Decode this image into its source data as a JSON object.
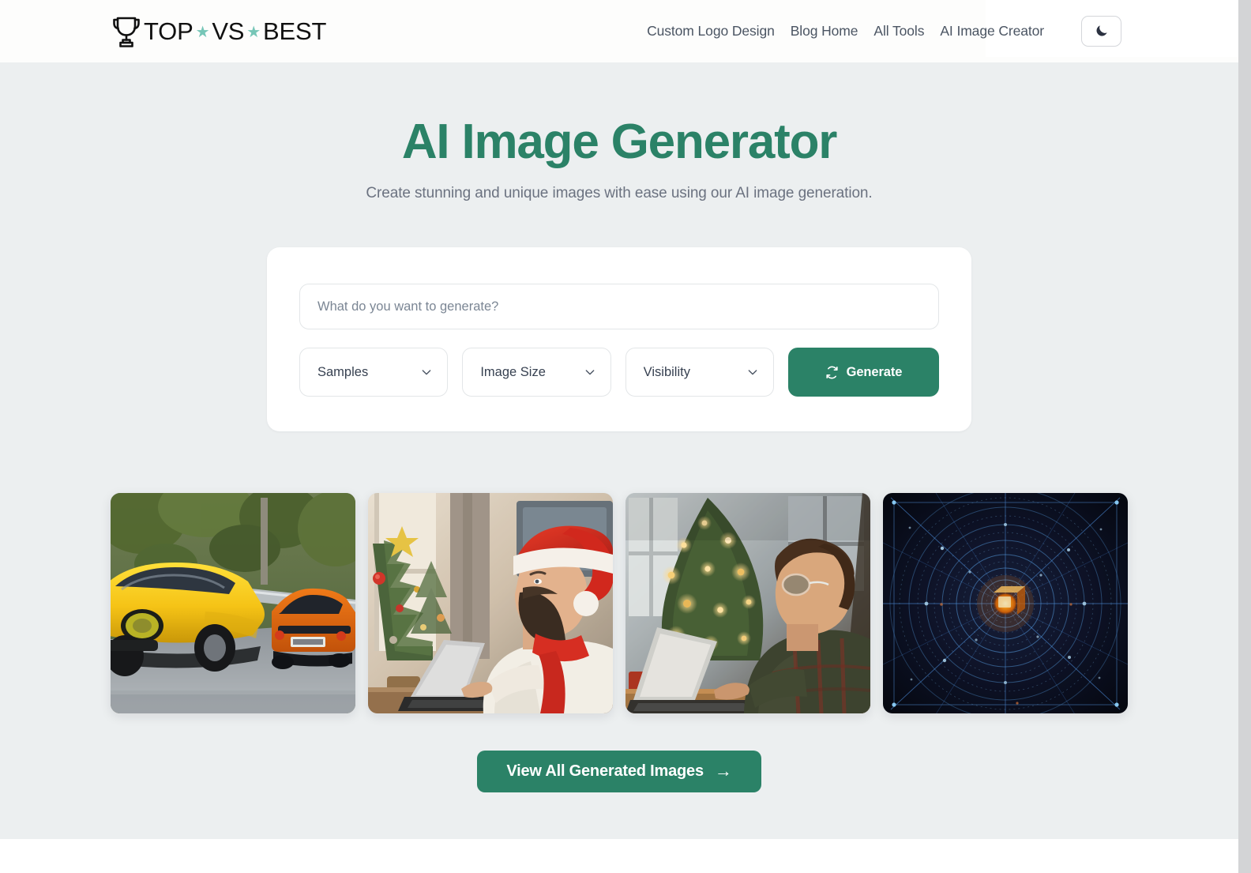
{
  "brand": {
    "icon": "trophy-icon",
    "word_one": "TOP",
    "word_two": "VS",
    "word_three": "BEST",
    "star_glyph": "★",
    "star_color": "#76c6b7"
  },
  "nav": {
    "links": [
      {
        "label": "Custom Logo Design",
        "name": "nav-link-custom-logo-design"
      },
      {
        "label": "Blog Home",
        "name": "nav-link-blog-home"
      },
      {
        "label": "All Tools",
        "name": "nav-link-all-tools"
      },
      {
        "label": "AI Image Creator",
        "name": "nav-link-ai-image-creator"
      }
    ],
    "theme_toggle": {
      "icon": "moon-icon",
      "label": "Toggle dark mode"
    }
  },
  "hero": {
    "title": "AI Image Generator",
    "subtitle": "Create stunning and unique images with ease using our AI image generation.",
    "title_color": "#2b8267"
  },
  "generator": {
    "prompt": {
      "placeholder": "What do you want to generate?",
      "value": ""
    },
    "selects": [
      {
        "label": "Samples",
        "name": "samples-select",
        "icon": "chevron-down-icon"
      },
      {
        "label": "Image Size",
        "name": "image-size-select",
        "icon": "chevron-down-icon"
      },
      {
        "label": "Visibility",
        "name": "visibility-select",
        "icon": "chevron-down-icon"
      }
    ],
    "generate_button": {
      "label": "Generate",
      "icon": "sync-refresh-icon",
      "color": "#2b8267"
    }
  },
  "gallery": {
    "items": [
      {
        "name": "generated-image-muscle-cars",
        "alt": "Yellow and orange classic muscle cars racing on a tree-lined road"
      },
      {
        "name": "generated-image-santa-hat-laptop",
        "alt": "Bearded man in a red Santa hat and scarf typing on a laptop beside a Christmas tree"
      },
      {
        "name": "generated-image-christmas-tree-laptop",
        "alt": "Man with glasses working on a laptop in front of a lit Christmas tree"
      },
      {
        "name": "generated-image-digital-web-tunnel",
        "alt": "Dark blue glowing digital spider-web tunnel with an orange cube at its center"
      }
    ]
  },
  "view_all": {
    "label": "View All Generated Images",
    "arrow": "→",
    "color": "#2b8267"
  }
}
